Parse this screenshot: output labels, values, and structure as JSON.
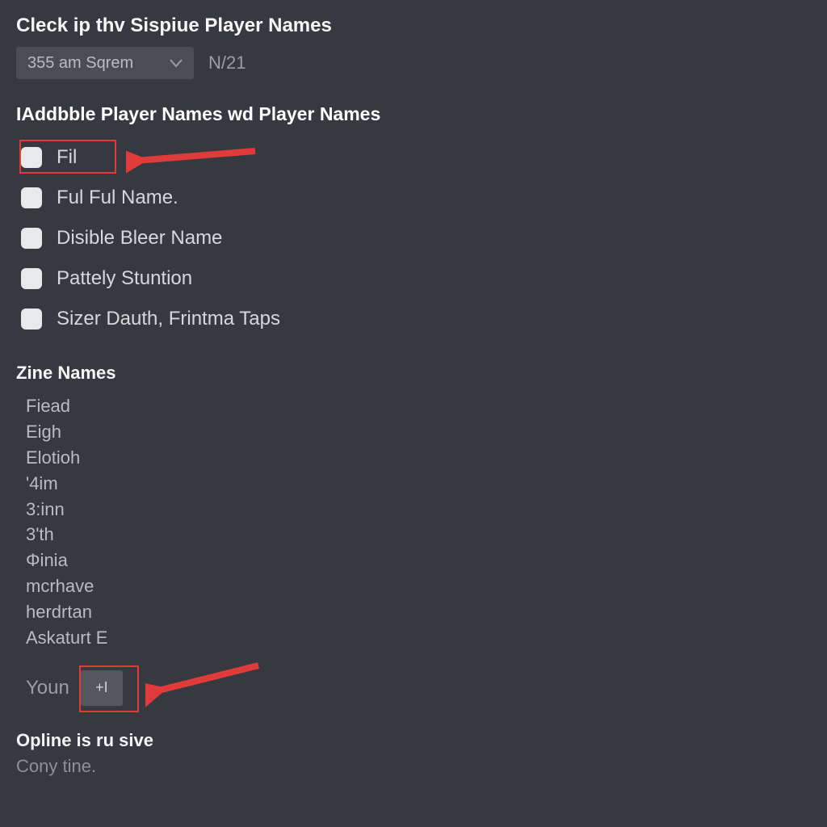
{
  "header": {
    "title": "Cleck ip thv Sispiue Player Names"
  },
  "select": {
    "value": "355 am Sqrem",
    "side_text": "N/21"
  },
  "section2": {
    "title": "IAddbble Player Names wd Player Names"
  },
  "options": [
    {
      "label": "Fil"
    },
    {
      "label": "Ful Ful Name."
    },
    {
      "label": "Disible Bleer Name"
    },
    {
      "label": "Pattely Stuntion"
    },
    {
      "label": "Sizer Dauth, Frintma Taps"
    }
  ],
  "section3": {
    "title": "Zine Names"
  },
  "zine_items": [
    "Fiead",
    "Eigh",
    "Elotioh",
    "'4im",
    "3:inn",
    "3'th",
    "Φinia",
    "mcrhave",
    "herdrtan",
    "Askaturt E"
  ],
  "youn": {
    "label": "Youn",
    "button": "+I"
  },
  "footer": {
    "title": "Opline is ru sive",
    "sub": "Cony tine."
  },
  "colors": {
    "highlight": "#e03b3b"
  }
}
